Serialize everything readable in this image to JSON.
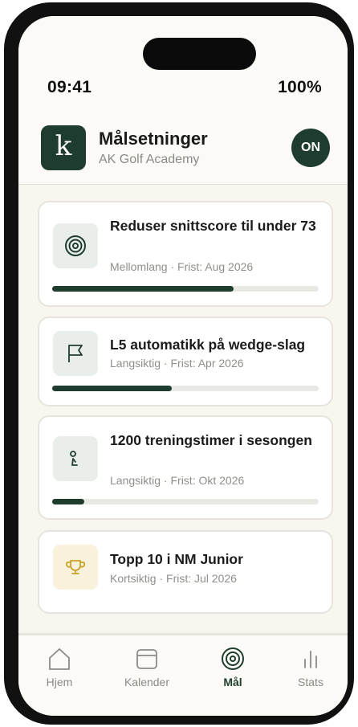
{
  "status_bar": {
    "time": "09:41",
    "battery": "100%"
  },
  "header": {
    "logo_letter": "k",
    "title": "Målsetninger",
    "subtitle": "AK Golf Academy",
    "avatar_initials": "ON"
  },
  "goals": [
    {
      "title": "Reduser snittscore til under 73",
      "meta": "Mellomlang · Frist: Aug 2026",
      "progress": 0.68,
      "icon": "target-icon"
    },
    {
      "title": "L5 automatikk på wedge-slag",
      "meta": "Langsiktig · Frist: Apr 2026",
      "progress": 0.45,
      "icon": "flag-icon"
    },
    {
      "title": "1200 treningstimer i sesongen",
      "meta": "Langsiktig · Frist: Okt 2026",
      "progress": 0.12,
      "icon": "golfer-icon"
    },
    {
      "title": "Topp 10 i NM Junior",
      "meta": "Kortsiktig · Frist: Jul 2026",
      "icon": "trophy-icon"
    }
  ],
  "tabbar": {
    "tabs": [
      {
        "label": "Hjem",
        "icon": "home-icon"
      },
      {
        "label": "Kalender",
        "icon": "calendar-icon"
      },
      {
        "label": "Mål",
        "icon": "target-icon",
        "active": true
      },
      {
        "label": "Stats",
        "icon": "bar-chart-icon"
      }
    ]
  },
  "colors": {
    "accent": "#1f3d2e",
    "background": "#f8f6ef",
    "gold": "#c9a227"
  }
}
